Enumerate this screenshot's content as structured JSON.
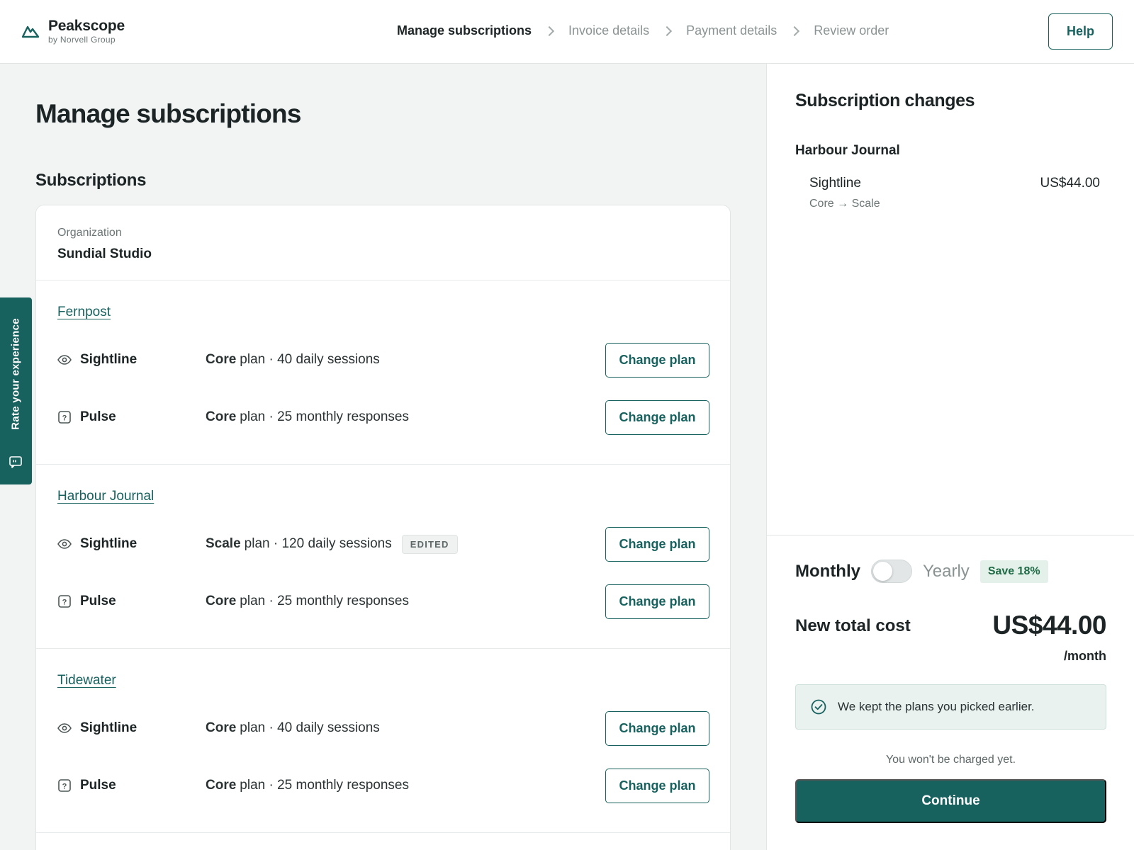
{
  "app": {
    "brand_name": "Peakscope",
    "brand_sub": "by Norvell Group"
  },
  "steps": [
    {
      "label": "Manage subscriptions",
      "active": true
    },
    {
      "label": "Invoice details",
      "active": false
    },
    {
      "label": "Payment details",
      "active": false
    },
    {
      "label": "Review order",
      "active": false
    }
  ],
  "header": {
    "help_label": "Help"
  },
  "main": {
    "title": "Manage subscriptions",
    "section_title": "Subscriptions",
    "organization_label": "Organization",
    "organization_name": "Sundial Studio",
    "groups": [
      {
        "name": "Fernpost",
        "rows": [
          {
            "icon": "eye-icon",
            "product": "Sightline",
            "plan": "Core",
            "detail": "plan · 40 daily sessions",
            "badge": "",
            "button": "Change plan"
          },
          {
            "icon": "question-square-icon",
            "product": "Pulse",
            "plan": "Core",
            "detail": "plan · 25 monthly responses",
            "badge": "",
            "button": "Change plan"
          }
        ]
      },
      {
        "name": "Harbour Journal",
        "rows": [
          {
            "icon": "eye-icon",
            "product": "Sightline",
            "plan": "Scale",
            "detail": "plan · 120 daily sessions",
            "badge": "EDITED",
            "button": "Change plan"
          },
          {
            "icon": "question-square-icon",
            "product": "Pulse",
            "plan": "Core",
            "detail": "plan · 25 monthly responses",
            "badge": "",
            "button": "Change plan"
          }
        ]
      },
      {
        "name": "Tidewater",
        "rows": [
          {
            "icon": "eye-icon",
            "product": "Sightline",
            "plan": "Core",
            "detail": "plan · 40 daily sessions",
            "badge": "",
            "button": "Change plan"
          },
          {
            "icon": "question-square-icon",
            "product": "Pulse",
            "plan": "Core",
            "detail": "plan · 25 monthly responses",
            "badge": "",
            "button": "Change plan"
          }
        ]
      }
    ]
  },
  "feedback": {
    "label": "Rate your experience"
  },
  "sidebar": {
    "title": "Subscription changes",
    "org": "Harbour Journal",
    "change": {
      "product": "Sightline",
      "transition": "Core → Scale",
      "price": "US$44.00"
    },
    "billing": {
      "monthly": "Monthly",
      "yearly": "Yearly",
      "save_badge": "Save 18%",
      "yearly_selected": false
    },
    "total_label": "New total cost",
    "total_amount": "US$44.00",
    "total_period": "/month",
    "notice": "We kept the plans you picked earlier.",
    "charge_note": "You won't be charged yet.",
    "continue_label": "Continue"
  },
  "colors": {
    "accent": "#17625f",
    "page_bg": "#f1f4f3",
    "success_bg": "#e9f2ee"
  }
}
